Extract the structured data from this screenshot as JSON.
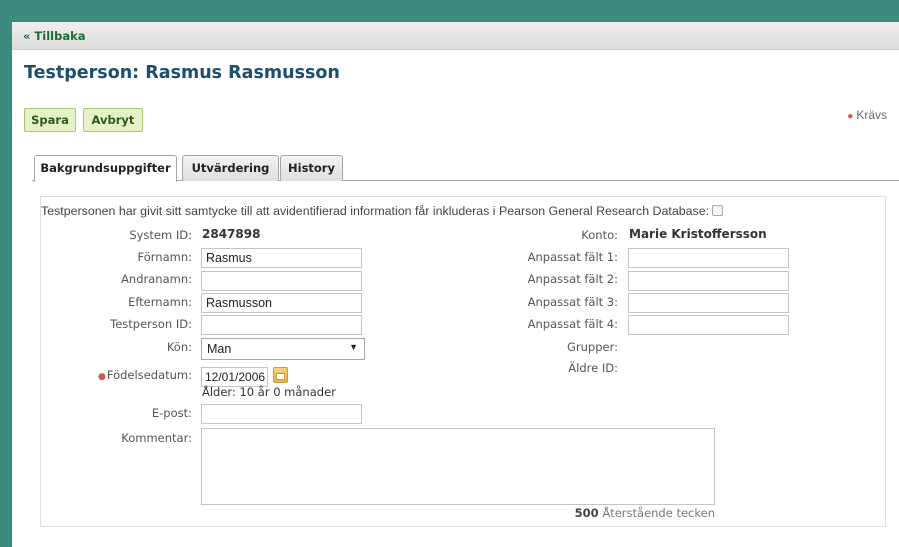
{
  "nav": {
    "back_label": "« Tillbaka"
  },
  "page": {
    "title": "Testperson: Rasmus Rasmusson"
  },
  "toolbar": {
    "save_label": "Spara",
    "cancel_label": "Avbryt",
    "required_label": "Krävs"
  },
  "tabs": [
    {
      "label": "Bakgrundsuppgifter",
      "active": true
    },
    {
      "label": "Utvärdering",
      "active": false
    },
    {
      "label": "History",
      "active": false
    }
  ],
  "consent": {
    "text": "Testpersonen har givit sitt samtycke till att avidentifierad information får inkluderas i Pearson General Research Database:",
    "checked": false
  },
  "form": {
    "system_id": {
      "label": "System ID:",
      "value": "2847898"
    },
    "fornamn": {
      "label": "Förnamn:",
      "value": "Rasmus"
    },
    "andranamn": {
      "label": "Andranamn:",
      "value": ""
    },
    "efternamn": {
      "label": "Efternamn:",
      "value": "Rasmusson"
    },
    "testperson_id": {
      "label": "Testperson ID:",
      "value": ""
    },
    "kon": {
      "label": "Kön:",
      "value": "Man"
    },
    "fodelsedatum": {
      "label": "Födelsedatum:",
      "value": "12/01/2006",
      "required": true
    },
    "alder": "Ålder: 10 år 0 månader",
    "epost": {
      "label": "E-post:",
      "value": ""
    },
    "kommentar": {
      "label": "Kommentar:",
      "value": "",
      "remaining_count": "500",
      "remaining_label": "Återstående tecken"
    },
    "konto": {
      "label": "Konto:",
      "value": "Marie Kristoffersson"
    },
    "anpassat1": {
      "label": "Anpassat fält 1:",
      "value": ""
    },
    "anpassat2": {
      "label": "Anpassat fält 2:",
      "value": ""
    },
    "anpassat3": {
      "label": "Anpassat fält 3:",
      "value": ""
    },
    "anpassat4": {
      "label": "Anpassat fält 4:",
      "value": ""
    },
    "grupper": {
      "label": "Grupper:"
    },
    "aldre_id": {
      "label": "Äldre ID:"
    }
  },
  "colors": {
    "brand": "#3d8a7e",
    "title": "#1c4e6e",
    "button_bg": "#e5f1c7",
    "required": "#d9534f"
  },
  "icons": {
    "date_picker": "calendar-icon",
    "select": "chevron-down-icon"
  }
}
